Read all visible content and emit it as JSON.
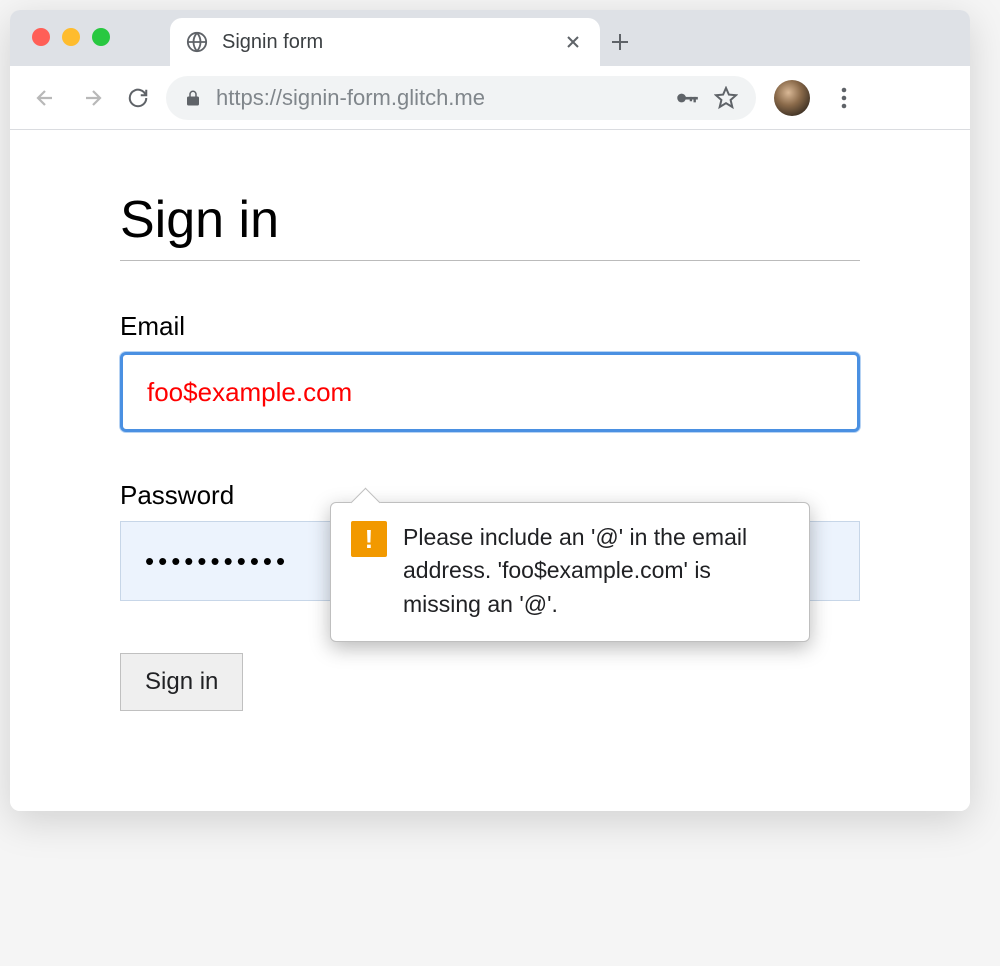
{
  "browser": {
    "tab_title": "Signin form",
    "url": "https://signin-form.glitch.me"
  },
  "page": {
    "heading": "Sign in",
    "email_label": "Email",
    "email_value": "foo$example.com",
    "password_label": "Password",
    "password_value": "•••••••••••",
    "submit_label": "Sign in"
  },
  "tooltip": {
    "icon": "!",
    "message": "Please include an '@' in the email address. 'foo$example.com' is missing an '@'."
  }
}
